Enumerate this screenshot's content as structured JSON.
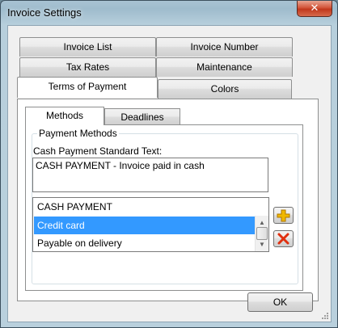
{
  "window": {
    "title": "Invoice Settings",
    "close_glyph": "✕"
  },
  "tabs": {
    "row1": [
      "Invoice List",
      "Invoice Number"
    ],
    "row2": [
      "Tax Rates",
      "Maintenance"
    ],
    "row3": [
      "Terms of Payment",
      "Colors"
    ],
    "active": "Terms of Payment"
  },
  "subtabs": {
    "items": [
      "Methods",
      "Deadlines"
    ],
    "active": "Methods"
  },
  "payment_methods": {
    "group_title": "Payment Methods",
    "cash_text_label": "Cash Payment Standard Text:",
    "cash_text_value": "CASH PAYMENT - Invoice paid in cash",
    "list": [
      "CASH PAYMENT",
      "Credit card",
      "Payable on delivery"
    ],
    "selected": "Credit card"
  },
  "buttons": {
    "ok_label": "OK",
    "add_icon": "plus-icon",
    "delete_icon": "delete-x-icon"
  },
  "colors": {
    "selection": "#3399ff",
    "add_icon": "#f0b800",
    "delete_icon": "#e03010"
  }
}
